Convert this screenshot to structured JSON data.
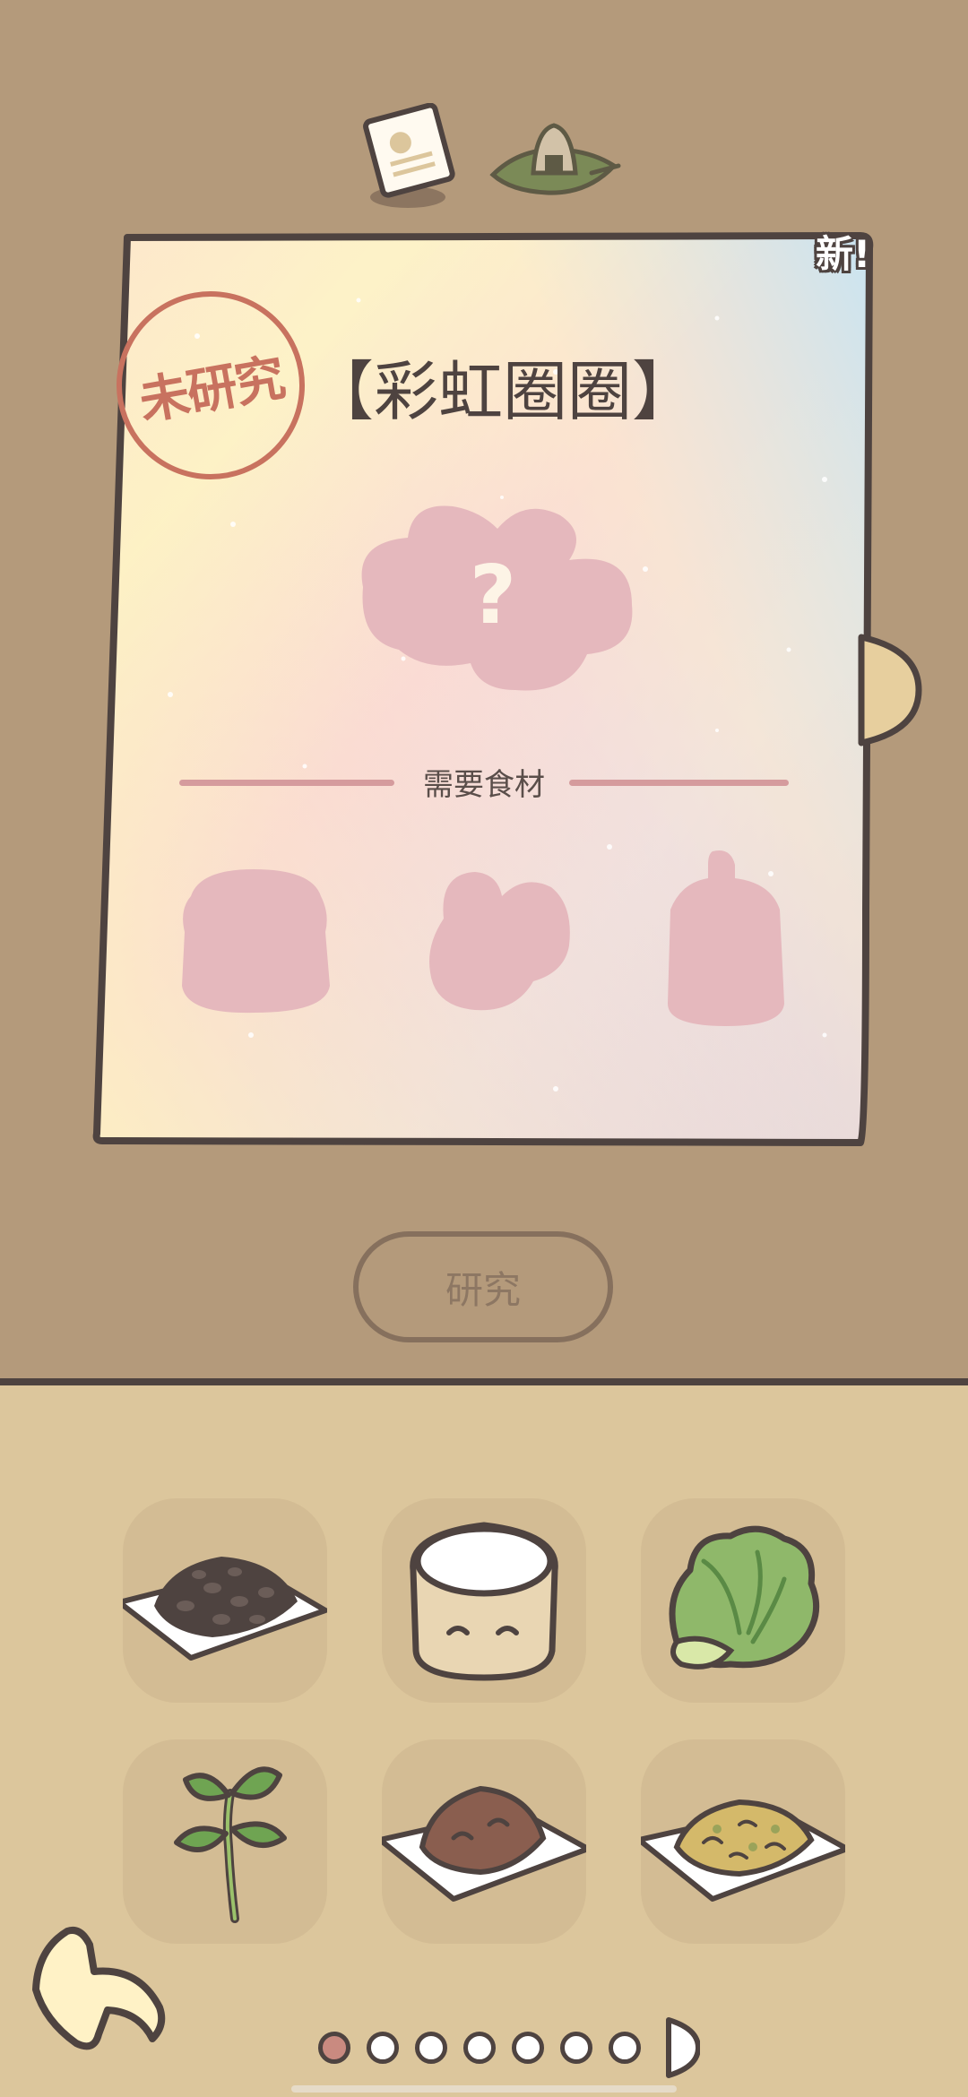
{
  "tabs": [
    {
      "name": "recipe-tab",
      "icon": "recipe-card-icon"
    },
    {
      "name": "food-tab",
      "icon": "rice-ball-on-leaf-icon"
    }
  ],
  "card": {
    "new_badge": "新!",
    "stamp_text": "未研究",
    "title": "【彩虹圈圈】",
    "mystery_icon": "question-mark-icon",
    "ingredients_label": "需要食材",
    "required_ingredients": [
      "unknown-ingredient-1",
      "unknown-ingredient-2",
      "unknown-ingredient-3"
    ]
  },
  "research_button": {
    "label": "研究"
  },
  "ingredient_grid": [
    {
      "name": "dark-beans-plate",
      "icon": "beans-plate-icon"
    },
    {
      "name": "flour-bag",
      "icon": "flour-bag-icon"
    },
    {
      "name": "lettuce",
      "icon": "lettuce-icon"
    },
    {
      "name": "herb-sprig",
      "icon": "herb-sprig-icon"
    },
    {
      "name": "brown-paste-plate",
      "icon": "brown-paste-plate-icon"
    },
    {
      "name": "yellow-flakes-plate",
      "icon": "yellow-flakes-plate-icon"
    }
  ],
  "pager": {
    "total": 7,
    "current": 1
  },
  "colors": {
    "top_background": "#b49a7b",
    "bottom_background": "#dcc69c",
    "outline": "#4e4340",
    "stamp": "#c8725f",
    "silhouette": "#e5b8bd"
  }
}
